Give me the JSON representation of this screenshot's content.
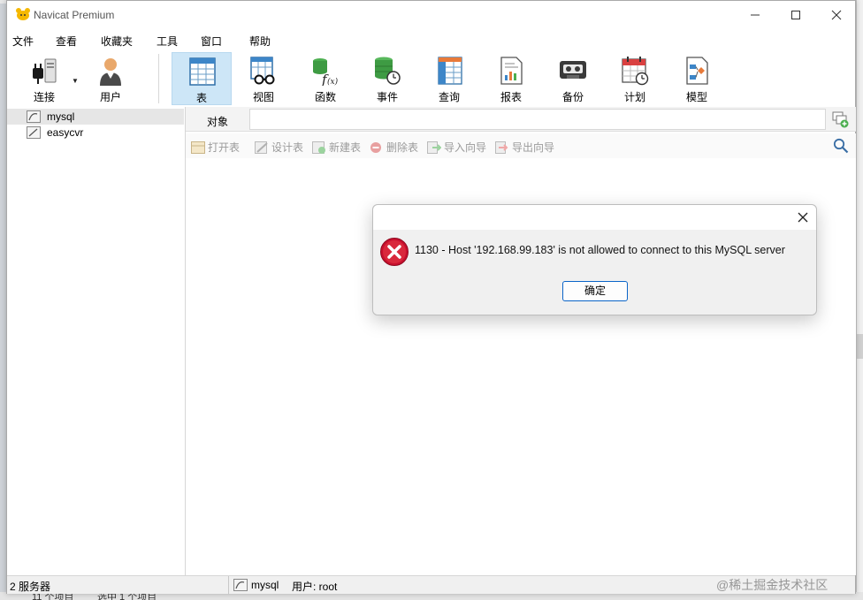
{
  "window": {
    "title": "Navicat Premium",
    "controls": {
      "minimize": "—",
      "maximize": "☐",
      "close": "✕"
    }
  },
  "menu": [
    "文件",
    "查看",
    "收藏夹",
    "工具",
    "窗口",
    "帮助"
  ],
  "toolbar": {
    "connect_label": "连接",
    "user_label": "用户",
    "items": [
      {
        "label": "表",
        "icon": "table-icon",
        "active": true
      },
      {
        "label": "视图",
        "icon": "view-icon",
        "active": false
      },
      {
        "label": "函数",
        "icon": "function-icon",
        "active": false
      },
      {
        "label": "事件",
        "icon": "event-icon",
        "active": false
      },
      {
        "label": "查询",
        "icon": "query-icon",
        "active": false
      },
      {
        "label": "报表",
        "icon": "report-icon",
        "active": false
      },
      {
        "label": "备份",
        "icon": "backup-icon",
        "active": false
      },
      {
        "label": "计划",
        "icon": "schedule-icon",
        "active": false
      },
      {
        "label": "模型",
        "icon": "model-icon",
        "active": false
      }
    ]
  },
  "sidebar": {
    "connections": [
      {
        "label": "mysql",
        "selected": true
      },
      {
        "label": "easycvr",
        "selected": false
      }
    ]
  },
  "object_tab": {
    "label": "对象"
  },
  "actions": [
    "打开表",
    "设计表",
    "新建表",
    "删除表",
    "导入向导",
    "导出向导"
  ],
  "status": {
    "count": "2 服务器",
    "connection": "mysql",
    "user": "用户: root"
  },
  "dialog": {
    "close": "✕",
    "message": "1130 - Host '192.168.99.183' is not allowed to connect to this MySQL server",
    "ok_label": "确定"
  },
  "background": {
    "bottom_left": "11 个项目",
    "bottom_mid": "选中 1 个项目"
  },
  "watermark": "@稀土掘金技术社区",
  "colors": {
    "accent": "#cde6f7",
    "error_red": "#c8102e",
    "ok_border": "#0a64c8"
  }
}
